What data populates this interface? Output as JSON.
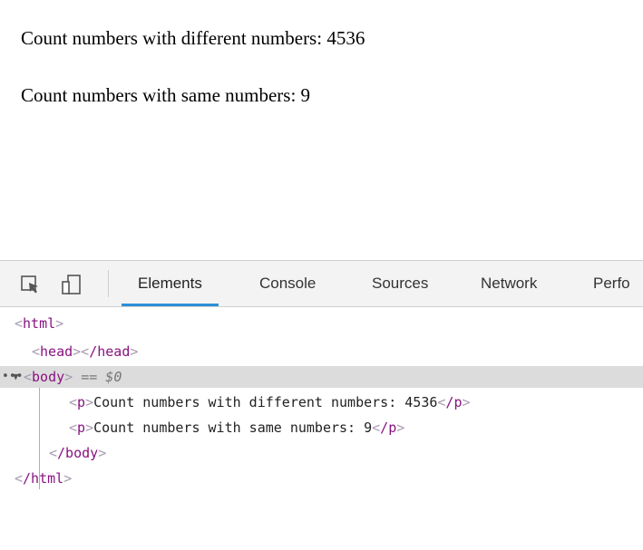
{
  "page": {
    "paragraphs": [
      "Count numbers with different numbers: 4536",
      "Count numbers with same numbers: 9"
    ]
  },
  "devtools": {
    "tabs": [
      "Elements",
      "Console",
      "Sources",
      "Network",
      "Perfo"
    ],
    "active_tab": "Elements",
    "accent_color": "#2d8fd8",
    "toolbar_icons": [
      "inspect-element-icon",
      "device-toolbar-icon"
    ],
    "tree": {
      "html_open": "html",
      "head": "head",
      "body": "body",
      "body_marker": "== $0",
      "p_tag": "p",
      "p1_text": "Count numbers with different numbers: 4536",
      "p2_text": "Count numbers with same numbers: 9",
      "body_close": "/body",
      "html_close": "/html",
      "head_close": "/head",
      "p_close": "/p"
    }
  }
}
